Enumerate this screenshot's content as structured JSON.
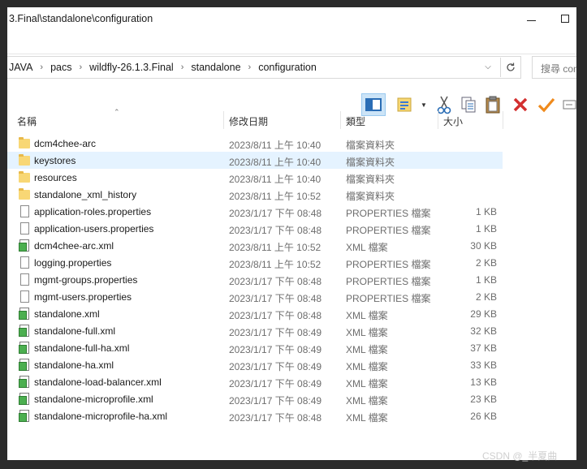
{
  "window": {
    "title": "3.Final\\standalone\\configuration"
  },
  "address": {
    "crumbs": [
      "JAVA",
      "pacs",
      "wildfly-26.1.3.Final",
      "standalone",
      "configuration"
    ],
    "search_placeholder": "搜尋 con"
  },
  "toolbar": {
    "icons": [
      "layout-pane-icon",
      "view-options-icon",
      "cut-icon",
      "copy-icon",
      "paste-icon",
      "delete-icon",
      "confirm-icon",
      "more-icon"
    ]
  },
  "columns": {
    "name": "名稱",
    "date": "修改日期",
    "type": "類型",
    "size": "大小"
  },
  "files": [
    {
      "name": "dcm4chee-arc",
      "date": "2023/8/11 上午 10:40",
      "type": "檔案資料夾",
      "size": "",
      "kind": "folder"
    },
    {
      "name": "keystores",
      "date": "2023/8/11 上午 10:40",
      "type": "檔案資料夾",
      "size": "",
      "kind": "folder"
    },
    {
      "name": "resources",
      "date": "2023/8/11 上午 10:40",
      "type": "檔案資料夾",
      "size": "",
      "kind": "folder"
    },
    {
      "name": "standalone_xml_history",
      "date": "2023/8/11 上午 10:52",
      "type": "檔案資料夾",
      "size": "",
      "kind": "folder"
    },
    {
      "name": "application-roles.properties",
      "date": "2023/1/17 下午 08:48",
      "type": "PROPERTIES 檔案",
      "size": "1 KB",
      "kind": "file"
    },
    {
      "name": "application-users.properties",
      "date": "2023/1/17 下午 08:48",
      "type": "PROPERTIES 檔案",
      "size": "1 KB",
      "kind": "file"
    },
    {
      "name": "dcm4chee-arc.xml",
      "date": "2023/8/11 上午 10:52",
      "type": "XML 檔案",
      "size": "30 KB",
      "kind": "xml"
    },
    {
      "name": "logging.properties",
      "date": "2023/8/11 上午 10:52",
      "type": "PROPERTIES 檔案",
      "size": "2 KB",
      "kind": "file"
    },
    {
      "name": "mgmt-groups.properties",
      "date": "2023/1/17 下午 08:48",
      "type": "PROPERTIES 檔案",
      "size": "1 KB",
      "kind": "file"
    },
    {
      "name": "mgmt-users.properties",
      "date": "2023/1/17 下午 08:48",
      "type": "PROPERTIES 檔案",
      "size": "2 KB",
      "kind": "file"
    },
    {
      "name": "standalone.xml",
      "date": "2023/1/17 下午 08:48",
      "type": "XML 檔案",
      "size": "29 KB",
      "kind": "xml"
    },
    {
      "name": "standalone-full.xml",
      "date": "2023/1/17 下午 08:49",
      "type": "XML 檔案",
      "size": "32 KB",
      "kind": "xml"
    },
    {
      "name": "standalone-full-ha.xml",
      "date": "2023/1/17 下午 08:49",
      "type": "XML 檔案",
      "size": "37 KB",
      "kind": "xml"
    },
    {
      "name": "standalone-ha.xml",
      "date": "2023/1/17 下午 08:49",
      "type": "XML 檔案",
      "size": "33 KB",
      "kind": "xml"
    },
    {
      "name": "standalone-load-balancer.xml",
      "date": "2023/1/17 下午 08:49",
      "type": "XML 檔案",
      "size": "13 KB",
      "kind": "xml"
    },
    {
      "name": "standalone-microprofile.xml",
      "date": "2023/1/17 下午 08:49",
      "type": "XML 檔案",
      "size": "23 KB",
      "kind": "xml"
    },
    {
      "name": "standalone-microprofile-ha.xml",
      "date": "2023/1/17 下午 08:48",
      "type": "XML 檔案",
      "size": "26 KB",
      "kind": "xml"
    }
  ],
  "selected_index": 1,
  "watermark": "CSDN @_半夏曲"
}
